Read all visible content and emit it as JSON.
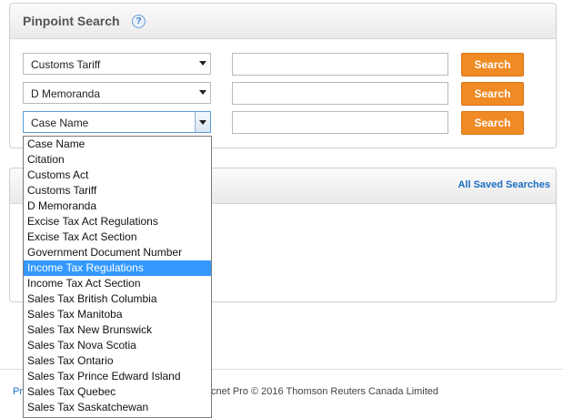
{
  "pinpoint": {
    "title": "Pinpoint Search",
    "help_icon_glyph": "?",
    "rows": [
      {
        "selected": "Customs Tariff",
        "input_value": "",
        "button": "Search"
      },
      {
        "selected": "D Memoranda",
        "input_value": "",
        "button": "Search"
      },
      {
        "selected": "Case Name",
        "input_value": "",
        "button": "Search"
      }
    ]
  },
  "saved_searches": {
    "link": "All Saved Searches"
  },
  "dropdown": {
    "highlighted": "Income Tax Regulations",
    "options": [
      "Case Name",
      "Citation",
      "Customs Act",
      "Customs Tariff",
      "D Memoranda",
      "Excise Tax Act Regulations",
      "Excise Tax Act Section",
      "Government Document Number",
      "Income Tax Regulations",
      "Income Tax Act Section",
      "Sales Tax British Columbia",
      "Sales Tax Manitoba",
      "Sales Tax New Brunswick",
      "Sales Tax Nova Scotia",
      "Sales Tax Ontario",
      "Sales Tax Prince Edward Island",
      "Sales Tax Quebec",
      "Sales Tax Saskatchewan"
    ]
  },
  "footer": {
    "left_fragment": "Pr",
    "copyright_fragment": "cnet Pro © 2016 Thomson Reuters Canada Limited"
  },
  "colors": {
    "accent_orange": "#f08a24",
    "link_blue": "#1a6fc2",
    "highlight_blue": "#3399ff"
  }
}
